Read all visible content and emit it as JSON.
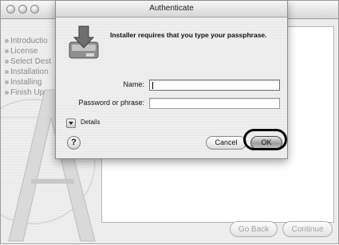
{
  "installer": {
    "steps": [
      "Introductio",
      "License",
      "Select Dest",
      "Installation",
      "Installing",
      "Finish Up"
    ],
    "go_back_label": "Go Back",
    "continue_label": "Continue"
  },
  "auth_dialog": {
    "title": "Authenticate",
    "message": "Installer requires that you type your passphrase.",
    "name_label": "Name:",
    "name_value": "",
    "password_label": "Password or phrase:",
    "password_value": "",
    "details_label": "Details",
    "help_label": "?",
    "cancel_label": "Cancel",
    "ok_label": "OK"
  }
}
